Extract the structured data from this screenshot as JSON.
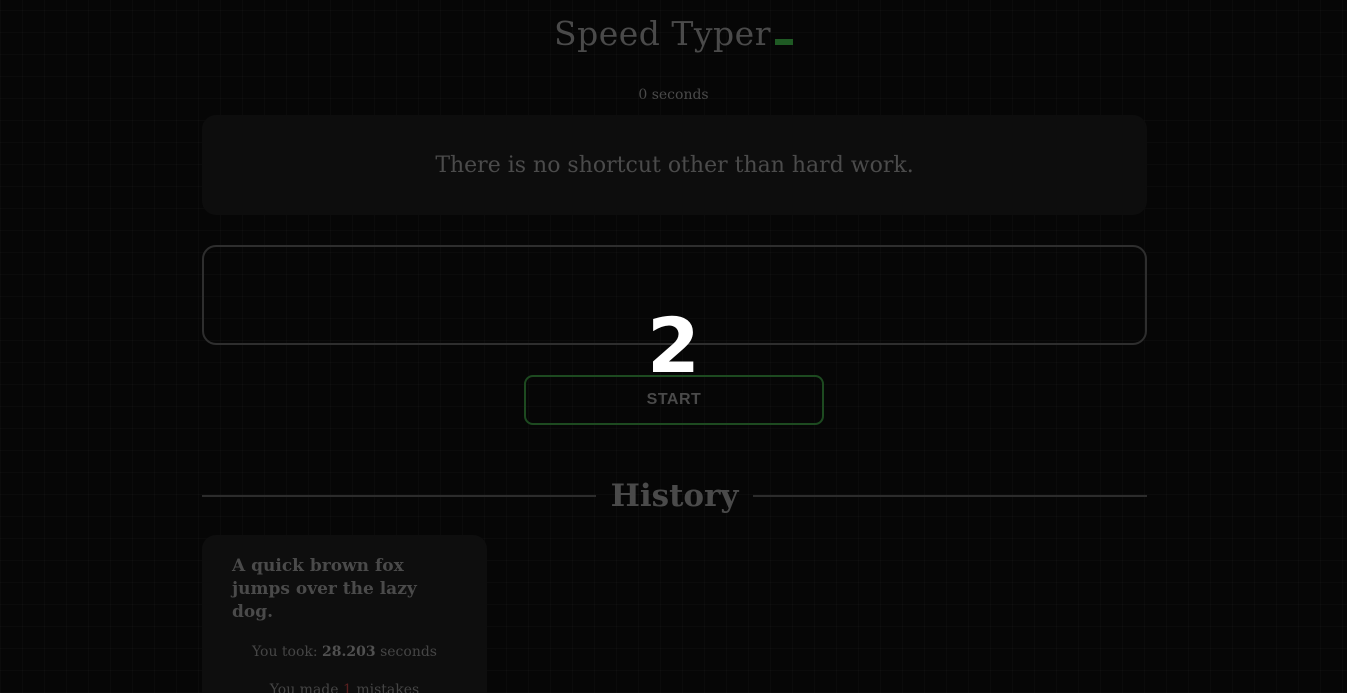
{
  "header": {
    "title": "Speed Typer",
    "timer_text": "0 seconds"
  },
  "quote": {
    "text": "There is no shortcut other than hard work."
  },
  "typing": {
    "value": "",
    "placeholder": ""
  },
  "countdown": {
    "value": "2"
  },
  "controls": {
    "start_label": "START"
  },
  "history": {
    "title": "History",
    "entries": [
      {
        "quote": "A quick brown fox jumps over the lazy dog.",
        "took_prefix": "You took: ",
        "time": "28.203",
        "took_suffix": " seconds",
        "mistakes_prefix": "You made ",
        "mistakes": "1",
        "mistakes_suffix": " mistakes"
      }
    ]
  },
  "colors": {
    "background": "#060606",
    "text_muted": "#4a4a4a",
    "accent_green": "#1f5a24",
    "mistake_red": "#5a2020",
    "countdown": "#ffffff"
  }
}
